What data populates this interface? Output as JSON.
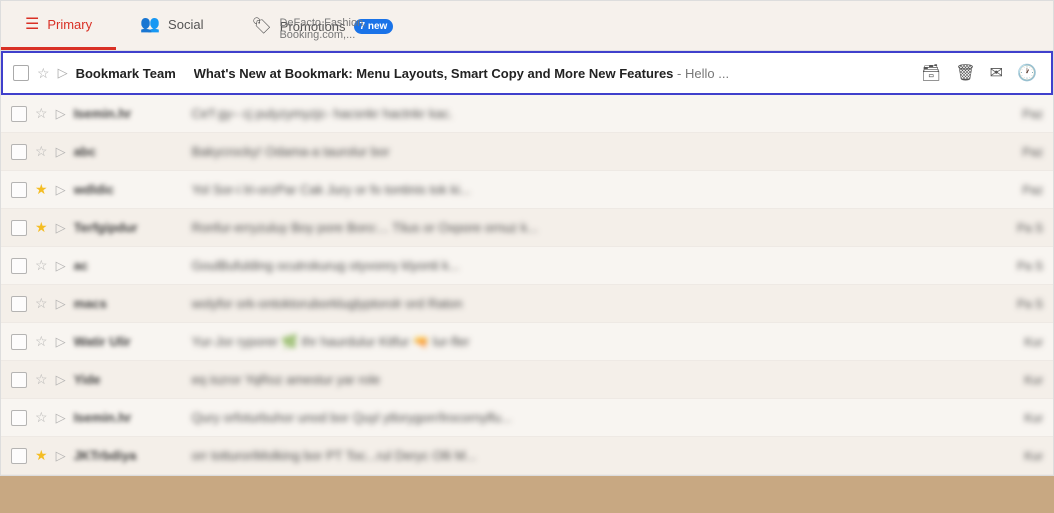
{
  "tabs": [
    {
      "id": "primary",
      "icon": "☰",
      "label": "Primary",
      "active": true,
      "new_badge": null,
      "subtitle": null
    },
    {
      "id": "social",
      "icon": "👥",
      "label": "Social",
      "active": false,
      "new_badge": null,
      "subtitle": null
    },
    {
      "id": "promotions",
      "icon": "🏷",
      "label": "Promotions",
      "active": false,
      "new_badge": "7 new",
      "subtitle": "DeFacto Fashion, Booking.com,..."
    }
  ],
  "highlighted_email": {
    "checked": false,
    "starred": false,
    "forwarded": false,
    "sender": "Bookmark Team",
    "subject": "What's New at Bookmark: Menu Layouts, Smart Copy and More New Features",
    "snippet": " - Hello ...",
    "timestamp": ""
  },
  "emails": [
    {
      "checked": false,
      "starred": false,
      "forwarded": false,
      "sender": "Isemin.hr",
      "subject_blurred": "Ce'f gy– cj pulyzymyzjc-  hacsnkr hactnkr kac.",
      "timestamp": "Paz"
    },
    {
      "checked": false,
      "starred": false,
      "forwarded": false,
      "sender": "abc",
      "subject_blurred": "Bakycrocky! Odama-a taurolur bor",
      "timestamp": "Paz"
    },
    {
      "checked": false,
      "starred": true,
      "forwarded": false,
      "sender": "wdldic",
      "subject_blurred": "Yol Sor-i lri-orzPar Cak Jury  or fo tontinis tok ki...",
      "timestamp": "Paz"
    },
    {
      "checked": false,
      "starred": true,
      "forwarded": false,
      "sender": "Terfgipdur",
      "subject_blurred": "Ronfur-erryzuluy Boy pore Boro:... Tlius or Oxpore ornuz k...",
      "timestamp": "Pa S"
    },
    {
      "checked": false,
      "starred": false,
      "forwarded": false,
      "sender": "ac",
      "subject_blurred": "GoulBufulding  ocutrokurug otyvonry klyonti k...",
      "timestamp": "Pa S"
    },
    {
      "checked": false,
      "starred": false,
      "forwarded": false,
      "sender": "macs",
      "subject_blurred": "wolyfor ork-ontoktoruborkluglyptorolr ord Raton",
      "timestamp": "Pa S"
    },
    {
      "checked": false,
      "starred": false,
      "forwarded": false,
      "sender": "Watir Ulir",
      "subject_blurred": "Yur-Jor ryporer 🌿 thr haurdulur Kitfur 🔫 lur-fler",
      "timestamp": "Kur"
    },
    {
      "checked": false,
      "starred": false,
      "forwarded": false,
      "sender": "Yide",
      "subject_blurred": "eq iszror YqRoz amestur yar role",
      "timestamp": "Kur"
    },
    {
      "checked": false,
      "starred": false,
      "forwarded": false,
      "sender": "Isemin.hr",
      "subject_blurred": "Qury orfoturbuhor unod bor Quyl ytlorygorr/lrocornylfu...",
      "timestamp": "Kur"
    },
    {
      "checked": false,
      "starred": true,
      "forwarded": false,
      "sender": "JKTrbdiya",
      "subject_blurred": "orr totturoriMolking bor PT Toc...rul Deryc Olli M...",
      "timestamp": "Kur"
    }
  ],
  "icons": {
    "archive": "🗃",
    "delete": "🗑",
    "mark_unread": "✉",
    "snooze": "🕐"
  }
}
